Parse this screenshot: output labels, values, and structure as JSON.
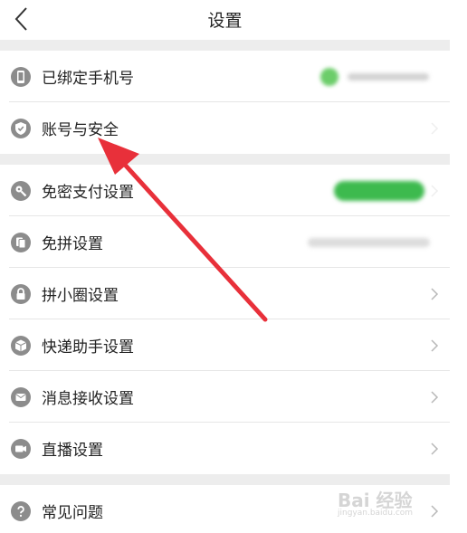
{
  "header": {
    "title": "设置",
    "back_icon": "chevron-left-icon"
  },
  "sections": [
    [
      {
        "label": "已绑定手机号",
        "icon": "phone-icon"
      },
      {
        "label": "账号与安全",
        "icon": "shield-icon"
      }
    ],
    [
      {
        "label": "免密支付设置",
        "icon": "key-icon"
      },
      {
        "label": "免拼设置",
        "icon": "cards-icon"
      },
      {
        "label": "拼小圈设置",
        "icon": "lock-icon"
      },
      {
        "label": "快递助手设置",
        "icon": "box-icon"
      },
      {
        "label": "消息接收设置",
        "icon": "envelope-icon"
      },
      {
        "label": "直播设置",
        "icon": "video-icon"
      }
    ],
    [
      {
        "label": "常见问题",
        "icon": "question-icon"
      }
    ]
  ],
  "watermark": {
    "main": "Bai 经验",
    "sub": "jingyan.baidu.com"
  },
  "colors": {
    "accent_green": "#3dba4e",
    "arrow_red": "#e8303a",
    "icon_gray": "#8c8c8c",
    "separator": "#ededed"
  }
}
